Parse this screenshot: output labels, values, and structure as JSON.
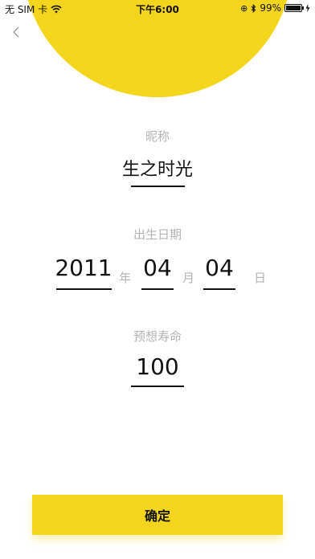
{
  "status_bar": {
    "carrier": "无 SIM 卡",
    "time": "下午6:00",
    "battery": "99%",
    "battery_level": 0.99
  },
  "form": {
    "nickname_label": "昵称",
    "nickname_value": "生之时光",
    "birthday_label": "出生日期",
    "year_value": "2011",
    "year_unit": "年",
    "month_value": "04",
    "month_unit": "月",
    "day_value": "04",
    "day_unit": "日",
    "lifespan_label": "预想寿命",
    "lifespan_value": "100"
  },
  "confirm_label": "确定",
  "colors": {
    "accent": "#F3D51D",
    "text": "#111111",
    "muted": "#B3B3B3"
  },
  "icons": {
    "back": "chevron-left-icon",
    "wifi": "wifi-icon",
    "lock": "orientation-lock-icon",
    "bluetooth": "bluetooth-icon",
    "battery": "battery-icon",
    "charging": "charging-icon"
  }
}
